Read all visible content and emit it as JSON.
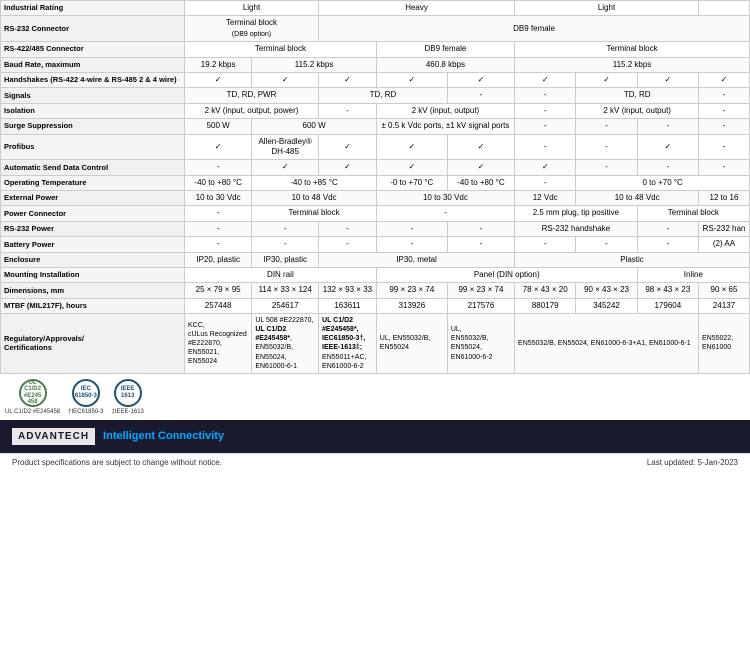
{
  "table": {
    "rows": [
      {
        "label": "Industrial Rating",
        "cols": [
          "Light",
          "Heavy",
          "Light",
          ""
        ]
      },
      {
        "label": "RS-232 Connector",
        "cols": [
          "Terminal block (DB9 option)",
          "DB9 female",
          "",
          ""
        ]
      },
      {
        "label": "RS-422/485 Connector",
        "cols": [
          "Terminal block",
          "DB9 female",
          "Terminal block",
          ""
        ]
      },
      {
        "label": "Baud Rate, maximum",
        "cols": [
          "19.2 kbps",
          "115.2 kbps",
          "460.8 kbps",
          "115.2 kbps"
        ]
      },
      {
        "label": "Handshakes (RS-422 4-wire & RS-485 2 & 4 wire)",
        "cols": [
          "✓",
          "✓",
          "✓",
          "✓",
          "✓",
          "✓",
          "✓"
        ]
      },
      {
        "label": "Signals",
        "cols": [
          "TD, RD, PWR",
          "TD, RD",
          "-",
          "-",
          "TD, RD",
          "-"
        ]
      },
      {
        "label": "Isolation",
        "cols": [
          "2 kV (input, output, power)",
          "-",
          "2 kV (input, output)",
          "-",
          "2 kV (input, output)",
          "-"
        ]
      },
      {
        "label": "Surge Suppression",
        "cols": [
          "500 W",
          "600 W",
          "± 0.5 k Vdc ports, ±1 kV signal ports",
          "-",
          "-",
          "-"
        ]
      },
      {
        "label": "Profibus",
        "cols": [
          "✓",
          "Allen-Bradley® DH-485",
          "✓",
          "✓",
          "-",
          "✓",
          "-"
        ]
      },
      {
        "label": "Automatic Send Data Control",
        "cols": [
          "-",
          "✓",
          "✓",
          "✓",
          "-",
          "-"
        ]
      },
      {
        "label": "Operating Temperature",
        "cols": [
          "-40 to +80 °C",
          "-40 to +85 °C",
          "-0 to +70 °C",
          "-40 to +80 °C",
          "0 to +70 °C",
          ""
        ]
      },
      {
        "label": "External Power",
        "cols": [
          "10 to 30 Vdc",
          "10 to 48 Vdc",
          "10 to 30 Vdc",
          "12 Vdc",
          "10 to 48 Vdc",
          "12 to 16"
        ]
      },
      {
        "label": "Power Connector",
        "cols": [
          "-",
          "Terminal block",
          "2.5 mm plug, tip positive",
          "Terminal block",
          ""
        ]
      },
      {
        "label": "RS-232 Power",
        "cols": [
          "-",
          "-",
          "-",
          "-",
          "RS-232 handshake",
          "-",
          "RS-232 han"
        ]
      },
      {
        "label": "Battery Power",
        "cols": [
          "-",
          "-",
          "-",
          "-",
          "-",
          "-"
        ]
      },
      {
        "label": "Enclosure",
        "cols": [
          "IP20, plastic",
          "IP30, plastic",
          "IP30, metal",
          "IP30, metal",
          "Plastic",
          ""
        ]
      },
      {
        "label": "Mounting Installation",
        "cols": [
          "DIN rail",
          "Panel (DIN option)",
          "Inline",
          ""
        ]
      },
      {
        "label": "Dimensions, mm",
        "cols": [
          "25 × 79 × 95",
          "114 × 33 × 124",
          "132 × 93 × 33",
          "99 × 23 × 74",
          "99 × 23 × 74",
          "78 × 43 × 20",
          "90 × 43 × 23",
          "98 × 43 × 23",
          "90 × 65"
        ]
      },
      {
        "label": "MTBF (MIL217F), hours",
        "cols": [
          "257448",
          "254617",
          "163611",
          "313926",
          "217576",
          "880179",
          "345242",
          "179604",
          "24137"
        ]
      }
    ],
    "regulatory_label": "Regulatory/Approvals/Certifications",
    "regulatory_cols": [
      "KCC, cULus Recognized #E222870, EN55021, EN55024",
      "UL 508 #E222870, UL C1/D2 #E245458*, EN55032/B, EN55024, EN61000-6-1",
      "UL C1/D2 #E245458*, IEC61850-3†, IEEE-1613‡; EN55011+AC, EN61000-6-2",
      "UL, EN55032/B, EN55024",
      "UL, EN55032/B, EN55024, EN61000-6-2",
      "EN55032/B, EN55024, EN61000-6-3+A1, EN61000-6-1",
      "EN55022, EN61000"
    ]
  },
  "certifications": [
    {
      "label": "UL C1/D2 #E245458",
      "display": "UL\nC1/D2\n#E245\n458"
    },
    {
      "label": "†IEC61850-3",
      "display": "IEC\n61850-3"
    },
    {
      "label": "‡IEEE-1613",
      "display": "IEEE\n1613"
    }
  ],
  "footer": {
    "logo": "ADVANTECH",
    "tagline": "Intelligent Connectivity",
    "disclaimer": "Product specifications are subject to change without notice.",
    "updated": "Last updated: 5-Jan-2023"
  }
}
